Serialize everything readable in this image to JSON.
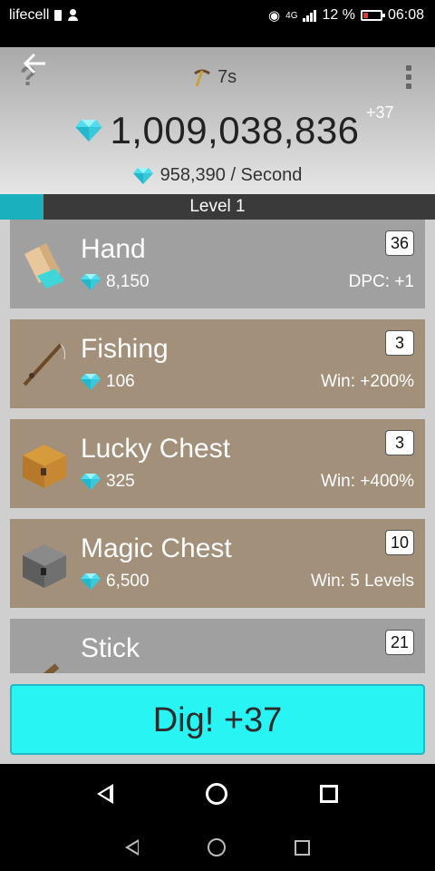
{
  "status_bar": {
    "carrier": "lifecell",
    "battery_percent": "12 %",
    "time": "06:08",
    "network": "4G"
  },
  "header": {
    "timer": "7s",
    "balance": "1,009,038,836",
    "balance_delta": "+37",
    "rate": "958,390 / Second"
  },
  "level": {
    "label": "Level 1",
    "progress": 0.1
  },
  "items": [
    {
      "name": "Hand",
      "cost": "8,150",
      "effect": "DPC: +1",
      "count": "36",
      "style": "gray"
    },
    {
      "name": "Fishing",
      "cost": "106",
      "effect": "Win: +200%",
      "count": "3",
      "style": "brown"
    },
    {
      "name": "Lucky Chest",
      "cost": "325",
      "effect": "Win: +400%",
      "count": "3",
      "style": "brown"
    },
    {
      "name": "Magic Chest",
      "cost": "6,500",
      "effect": "Win: 5 Levels",
      "count": "10",
      "style": "brown"
    },
    {
      "name": "Stick",
      "cost": "",
      "effect": "",
      "count": "21",
      "style": "gray"
    }
  ],
  "dig_button": {
    "label": "Dig! +37"
  },
  "colors": {
    "accent": "#28f4f4",
    "level_fill": "#18b1bc",
    "card_gray": "#a0a0a0",
    "card_brown": "#a3907b"
  }
}
